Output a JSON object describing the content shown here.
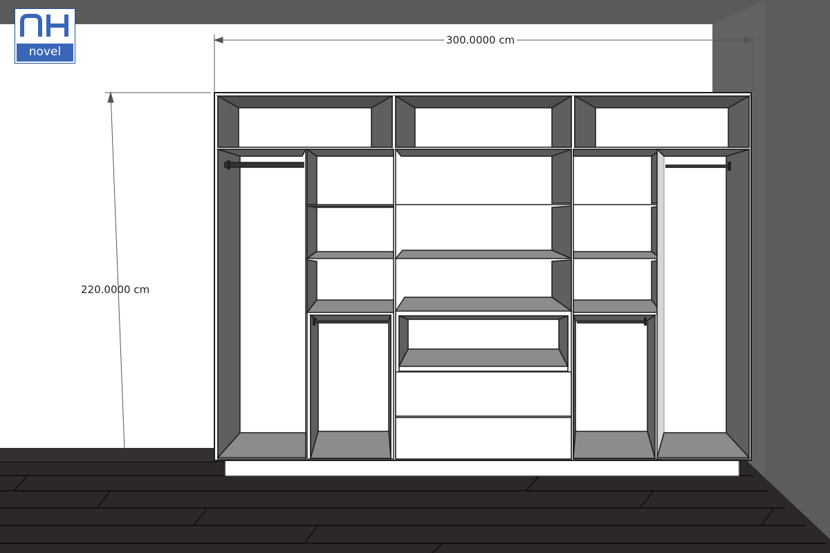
{
  "logo": {
    "brand": "NH",
    "name": "novel"
  },
  "dimensions": {
    "width_label": "300.0000 cm",
    "height_label": "220.0000 cm"
  },
  "colors": {
    "wall": "#ffffff",
    "side_wall": "#5e5e5e",
    "cabinet_edge": "#ffffff",
    "cabinet_back": "#ffffff",
    "cabinet_side": "#5f5f5f",
    "cabinet_shelf": "#8c8c8c",
    "floor": "#2b2727",
    "logo_blue": "#3a66b8"
  }
}
